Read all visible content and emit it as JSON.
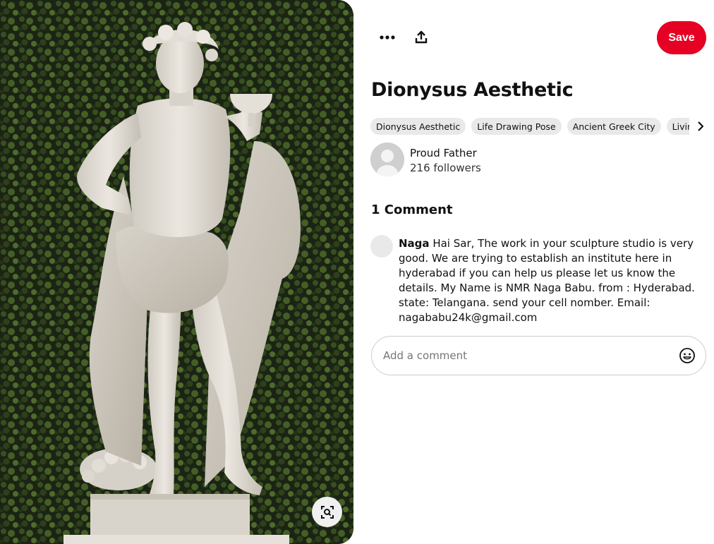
{
  "pin": {
    "title": "Dionysus Aesthetic",
    "image_subject": "marble statue of Dionysus holding a cup, hedge background"
  },
  "toolbar": {
    "more_icon": "more-horizontal-icon",
    "share_icon": "share-upload-icon",
    "save_label": "Save"
  },
  "tags": [
    {
      "label": "Dionysus Aesthetic"
    },
    {
      "label": "Life Drawing Pose"
    },
    {
      "label": "Ancient Greek City"
    },
    {
      "label": "Living Statue"
    }
  ],
  "tags_next_icon": "chevron-right-icon",
  "creator": {
    "name": "Proud Father",
    "followers": "216 followers"
  },
  "comments": {
    "heading": "1 Comment",
    "items": [
      {
        "author": "Naga",
        "text": "Hai Sar, The work in your sculpture studio is very good. We are trying to establish an institute here in hyderabad if you can help us please let us know the details. My Name is NMR Naga Babu. from : Hyderabad. state: Telangana. send your cell nomber. Email: nagababu24k@gmail.com"
      }
    ],
    "input_placeholder": "Add a comment",
    "emoji_icon": "smiley-icon"
  },
  "visual_search_icon": "visual-search-icon",
  "colors": {
    "save_button": "#e60023",
    "tag_background": "#e9e9e9"
  }
}
